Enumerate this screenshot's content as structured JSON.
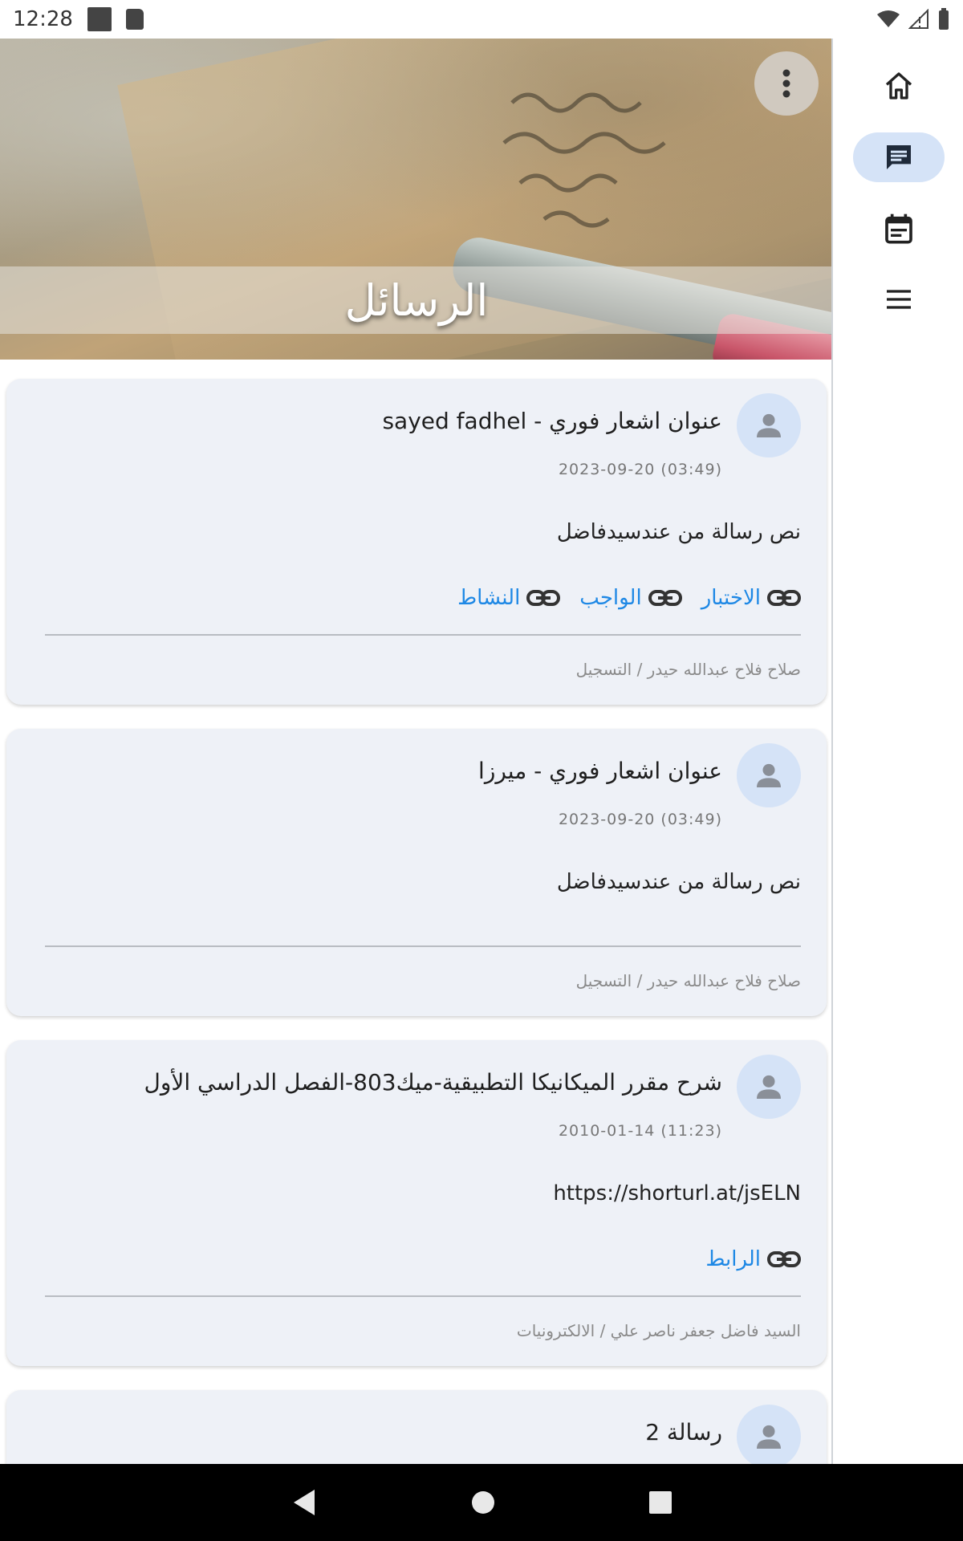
{
  "status_bar": {
    "time": "12:28"
  },
  "header": {
    "title": "الرسائل"
  },
  "messages": [
    {
      "title": "عنوان اشعار فوري - sayed fadhel",
      "date": "2023-09-20 (03:49)",
      "body": "نص رسالة من عندسيدفاضل",
      "links": [
        "الاختبار",
        "الواجب",
        "النشاط"
      ],
      "footer": "صلاح فلاح عبدالله حيدر / التسجيل"
    },
    {
      "title": "عنوان اشعار فوري - ميرزا",
      "date": "2023-09-20 (03:49)",
      "body": "نص رسالة من عندسيدفاضل",
      "links": [],
      "footer": "صلاح فلاح عبدالله حيدر / التسجيل"
    },
    {
      "title": "شرح مقرر الميكانيكا التطبيقية-ميك803-الفصل الدراسي الأول",
      "date": "2010-01-14 (11:23)",
      "body": "https://shorturl.at/jsELN",
      "links": [
        "الرابط"
      ],
      "footer": "السيد فاضل جعفر ناصر علي / الالكترونيات"
    },
    {
      "title": "رسالة 2"
    }
  ],
  "nav_rail": [
    {
      "icon": "home-icon",
      "active": false
    },
    {
      "icon": "message-icon",
      "active": true
    },
    {
      "icon": "calendar-icon",
      "active": false
    },
    {
      "icon": "menu-icon",
      "active": false
    }
  ],
  "colors": {
    "accent_link": "#1e88e5",
    "card_bg": "#eef1f7",
    "active_pill": "#d5e3f7"
  }
}
